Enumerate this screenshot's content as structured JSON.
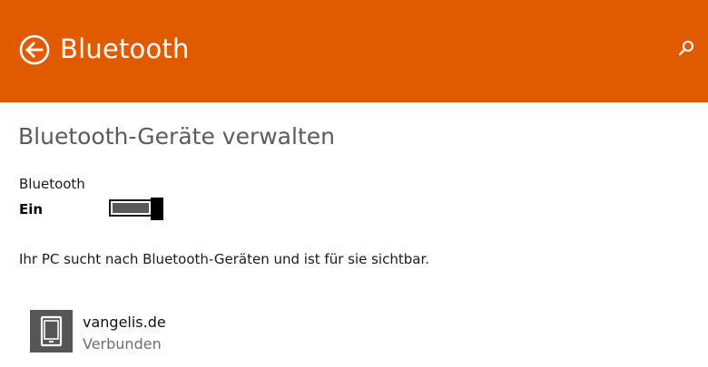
{
  "header": {
    "title": "Bluetooth",
    "back_icon": "back-arrow-circle-icon",
    "search_icon": "search-icon",
    "accent_color": "#e05b00"
  },
  "main": {
    "section_title": "Bluetooth-Geräte verwalten",
    "bluetooth_toggle": {
      "label": "Bluetooth",
      "state_label": "Ein",
      "on": true
    },
    "status_text": "Ihr PC sucht nach Bluetooth-Geräten und ist für sie sichtbar.",
    "devices": [
      {
        "name": "vangelis.de",
        "status": "Verbunden",
        "icon": "phone-icon"
      }
    ]
  }
}
